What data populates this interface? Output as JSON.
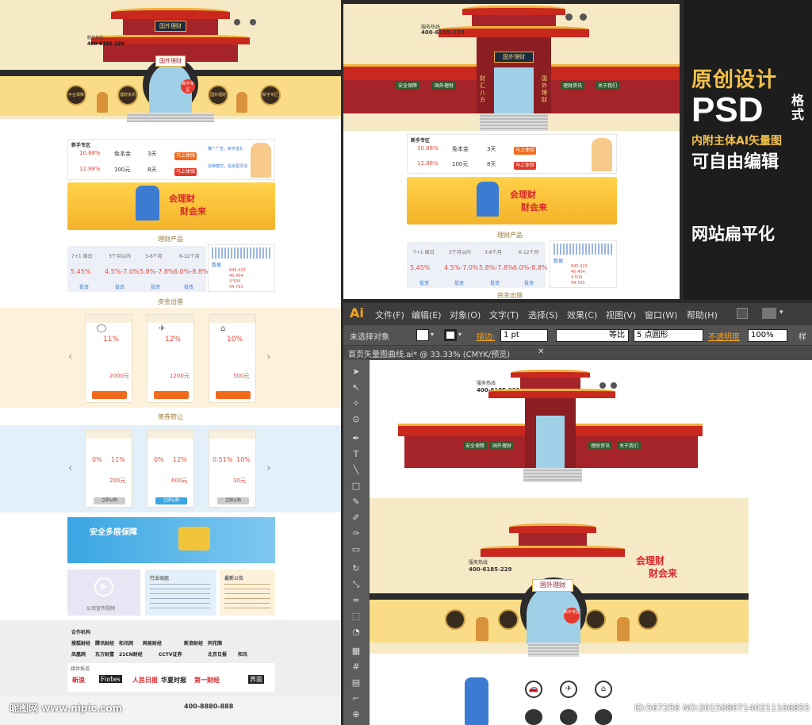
{
  "left_page": {
    "hero": {
      "hotline_label": "服务热线",
      "hotline": "400-6185-229",
      "sign": "国外理财",
      "medals": [
        "平台保障",
        "理财资讯",
        "国外理财",
        "新手专区"
      ],
      "gate_badge": "新手专区"
    },
    "newbie": {
      "title": "新手专区",
      "rows": [
        {
          "rate": "10.88%",
          "product": "免本金",
          "term": "3天",
          "button": "马上体验"
        },
        {
          "rate": "12.88%",
          "product": "100元",
          "term": "8天",
          "button": "马上体验"
        }
      ],
      "links": [
        "推广广告，新手送礼",
        "多种模式，投资更灵活"
      ]
    },
    "banner": {
      "text1": "会理财",
      "text2": "财会来"
    },
    "products": {
      "title": "理财产品",
      "cols": [
        {
          "name": "7+1 周日",
          "sub": "新手理财",
          "rate": "5.45%"
        },
        {
          "name": "3个月以内",
          "sub": "",
          "rate": "4.5%-7.0%"
        },
        {
          "name": "3-6个月",
          "sub": "",
          "rate": "5.8%-7.8%"
        },
        {
          "name": "6-12个月",
          "sub": "",
          "rate": "6.0%-8.8%"
        }
      ],
      "btn": "投资",
      "data_label": "数据",
      "data_values": [
        "645.423",
        "46.404",
        "4.504",
        "94.793"
      ]
    },
    "funds": {
      "title": "资金出借",
      "cards": [
        {
          "rate": "11%",
          "amount": "2000元"
        },
        {
          "rate": "12%",
          "amount": "1200元"
        },
        {
          "rate": "10%",
          "amount": "500元"
        }
      ]
    },
    "transfer": {
      "title": "债券转让",
      "cards": [
        {
          "r1": "0%",
          "r2": "11%",
          "amount": "200元"
        },
        {
          "r1": "0%",
          "r2": "12%",
          "amount": "600元"
        },
        {
          "r1": "0.51%",
          "r2": "10%",
          "amount": "30元"
        }
      ],
      "btn": "立即认购"
    },
    "security": {
      "title": "安全多层保障"
    },
    "video": {
      "label": "公司宣传视频"
    },
    "news": {
      "title": "行业动态",
      "notice": "最新公告"
    },
    "partners": {
      "title": "合作机构",
      "logos": [
        "搜狐财经",
        "腾讯财经",
        "和讯网",
        "网易财经",
        "新浪财经",
        "同花顺",
        "凤凰网",
        "东方财富",
        "21CN财经",
        "CCTV证券",
        "北京日报",
        "和讯"
      ],
      "media_title": "媒体报道",
      "media": [
        "新浪",
        "Forbes",
        "人民日报",
        "华夏时报",
        "第一财经",
        "界面"
      ]
    },
    "footer": {
      "phone": "400-8880-888"
    }
  },
  "right_top": {
    "hotline_label": "服务热线",
    "hotline": "400-6185-229",
    "sign": "国外理财",
    "menus": [
      "安全保障",
      "国外理财",
      "理财资讯",
      "关于我们"
    ],
    "pillars": [
      "财汇八方",
      "国外理财"
    ],
    "newbie_title": "新手专区",
    "rows": [
      {
        "rate": "10.88%",
        "product": "免本金",
        "term": "3天",
        "button": "马上体验"
      },
      {
        "rate": "12.88%",
        "product": "100元",
        "term": "8天",
        "button": "马上体验"
      }
    ],
    "banner1": "会理财",
    "banner2": "财会来",
    "products_title": "理财产品",
    "cols": [
      {
        "name": "7+1 周日",
        "sub": "新手理财",
        "rate": "5.45%"
      },
      {
        "name": "3个月以内",
        "rate": "4.5%-7.0%"
      },
      {
        "name": "3-6个月",
        "rate": "5.8%-7.8%"
      },
      {
        "name": "6-12个月",
        "rate": "6.0%-8.8%"
      }
    ],
    "btn": "投资",
    "data_label": "数据",
    "data_values": [
      "645.423",
      "46.404",
      "4.504",
      "94.793"
    ],
    "funds_title": "资金出借"
  },
  "promo": {
    "line1": "原创设计",
    "line2": "PSD",
    "line2b": "格式",
    "line3": "内附主体AI矢量图",
    "line4": "可自由编辑",
    "line5": "网站扁平化"
  },
  "illustrator": {
    "logo": "Ai",
    "menus": [
      "文件(F)",
      "编辑(E)",
      "对象(O)",
      "文字(T)",
      "选择(S)",
      "效果(C)",
      "视图(V)",
      "窗口(W)",
      "帮助(H)"
    ],
    "control": {
      "selection": "未选择对象",
      "stroke_label": "描边:",
      "stroke_value": "1 pt",
      "profile": "等比",
      "brush": "5 点圆形",
      "opacity_label": "不透明度",
      "opacity_value": "100%",
      "style_label": "样"
    },
    "doc_tab": "首页矢量图曲线.ai* @ 33.33% (CMYK/预览)",
    "canvas": {
      "hotline_label": "服务热线",
      "hotline": "400-6185-229",
      "menus": [
        "安全保障",
        "国外理财",
        "理财资讯",
        "关于我们"
      ],
      "sign": "国外理财",
      "banner1": "会理财",
      "banner2": "财会来",
      "gate_badge": "新手专区"
    }
  },
  "watermark": {
    "logo": "昵图网 www.nipic.com",
    "id": "ID:567256 NO:20150807140211106855"
  },
  "colors": {
    "roof_red": "#c8281e",
    "gold": "#f0b23a",
    "wall": "#a5242a",
    "accent_orange": "#f26b1d"
  }
}
